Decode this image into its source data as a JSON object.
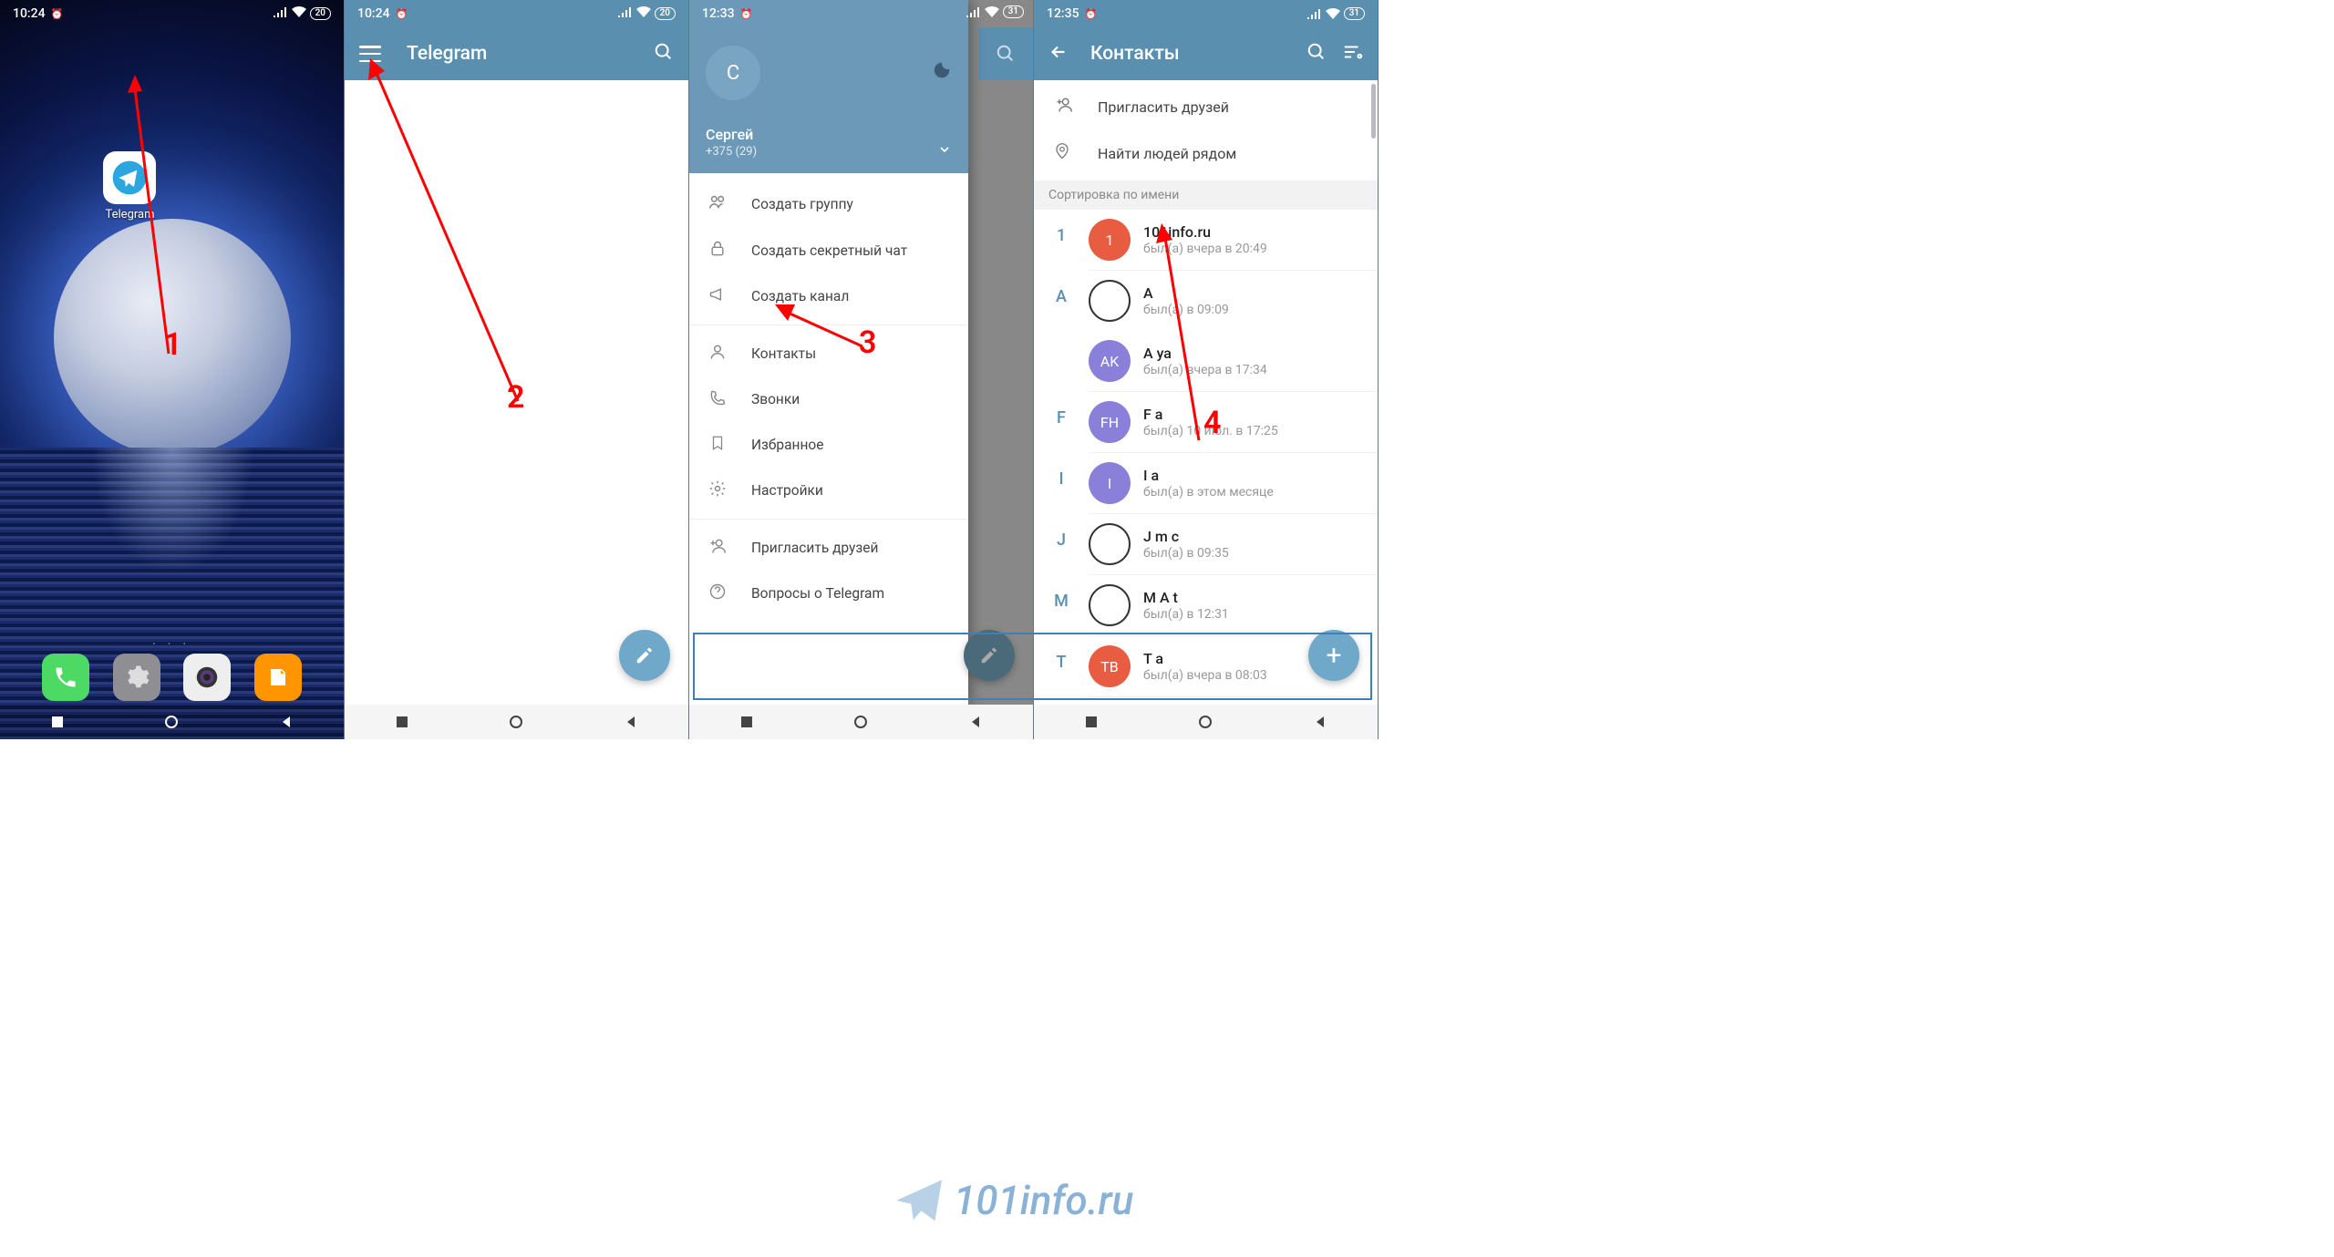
{
  "s1": {
    "time": "10:24",
    "battery": "20",
    "app_label": "Telegram",
    "step": "1"
  },
  "s2": {
    "time": "10:24",
    "battery": "20",
    "title": "Telegram",
    "step": "2"
  },
  "s3": {
    "time": "12:33",
    "battery": "31",
    "avatar_letter": "С",
    "user_name": "Сергей",
    "user_phone": "+375 (29)",
    "items": {
      "group": "Создать группу",
      "secret": "Создать секретный чат",
      "channel": "Создать канал",
      "contacts": "Контакты",
      "calls": "Звонки",
      "saved": "Избранное",
      "settings": "Настройки",
      "invite": "Пригласить друзей",
      "faq": "Вопросы о Telegram"
    },
    "step": "3"
  },
  "s4": {
    "time": "12:35",
    "battery": "31",
    "title": "Контакты",
    "invite": "Пригласить друзей",
    "nearby": "Найти людей рядом",
    "sort_header": "Сортировка по имени",
    "contacts": [
      {
        "letter": "1",
        "av": "1",
        "color": "#e85c42",
        "name": "101info.ru",
        "status": "был(а) вчера в 20:49"
      },
      {
        "letter": "А",
        "av": "",
        "color": "#ddd",
        "name": "А",
        "status": "был(а) в 09:09"
      },
      {
        "letter": "",
        "av": "AK",
        "color": "#8a7fd9",
        "name": "А            ya",
        "status": "был(а) вчера в 17:34"
      },
      {
        "letter": "F",
        "av": "FH",
        "color": "#8a7fd9",
        "name": "F                 a",
        "status": "был(а) 10 июл. в 17:25"
      },
      {
        "letter": "I",
        "av": "I",
        "color": "#8a7fd9",
        "name": "I   a",
        "status": "был(а) в этом месяце"
      },
      {
        "letter": "J",
        "av": "",
        "color": "#ddd",
        "name": "J m        c",
        "status": "был(а) в 09:35"
      },
      {
        "letter": "M",
        "av": "",
        "color": "#ddd",
        "name": "M     A            t",
        "status": "был(а) в 12:31"
      },
      {
        "letter": "T",
        "av": "ТВ",
        "color": "#e85c42",
        "name": "T                 a",
        "status": "был(а) вчера в 08:03"
      }
    ],
    "step": "4"
  },
  "watermark": "101info.ru"
}
